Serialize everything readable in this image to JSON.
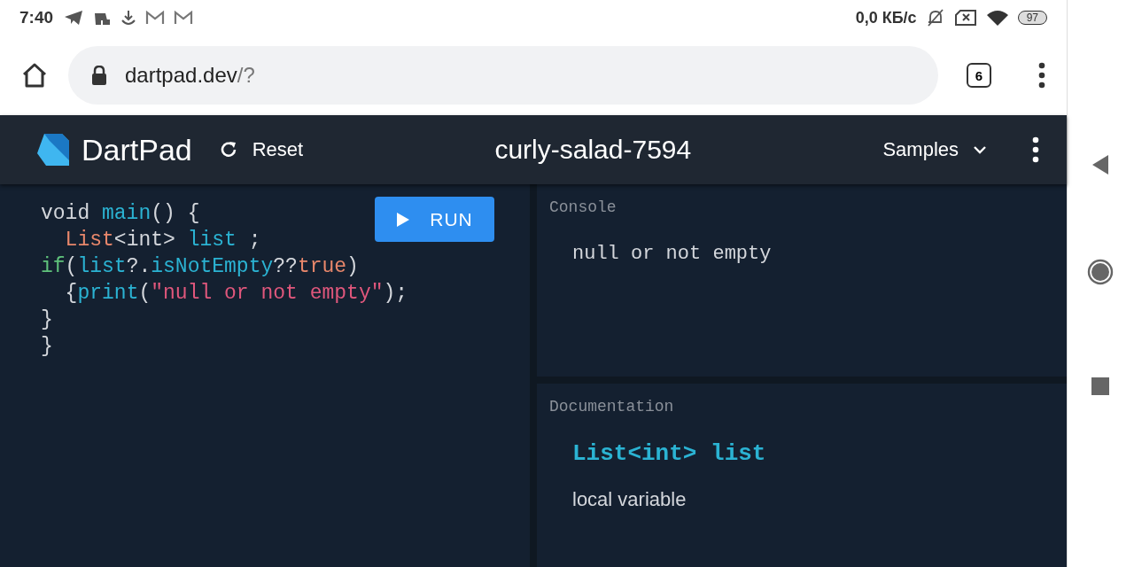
{
  "status_bar": {
    "time": "7:40",
    "net_speed": "0,0 КБ/с",
    "battery": "97"
  },
  "browser": {
    "url_host": "dartpad.dev",
    "url_path": "/?",
    "tab_count": "6"
  },
  "header": {
    "app_name": "DartPad",
    "reset": "Reset",
    "title": "curly-salad-7594",
    "samples": "Samples"
  },
  "editor": {
    "run_label": "RUN",
    "lines": [
      [
        {
          "kind": "plain",
          "text": "void "
        },
        {
          "kind": "ident",
          "text": "main"
        },
        {
          "kind": "plain",
          "text": "() {"
        }
      ],
      [
        {
          "kind": "type",
          "text": "  List"
        },
        {
          "kind": "plain",
          "text": "<int> "
        },
        {
          "kind": "ident",
          "text": "list"
        },
        {
          "kind": "plain",
          "text": " ;"
        }
      ],
      [
        {
          "kind": "keyword",
          "text": "if"
        },
        {
          "kind": "plain",
          "text": "("
        },
        {
          "kind": "ident",
          "text": "list"
        },
        {
          "kind": "plain",
          "text": "?."
        },
        {
          "kind": "ident",
          "text": "isNotEmpty"
        },
        {
          "kind": "plain",
          "text": "??"
        },
        {
          "kind": "type",
          "text": "true"
        },
        {
          "kind": "plain",
          "text": ")"
        }
      ],
      [
        {
          "kind": "plain",
          "text": "  {"
        },
        {
          "kind": "ident",
          "text": "print"
        },
        {
          "kind": "plain",
          "text": "("
        },
        {
          "kind": "string",
          "text": "\"null or not empty\""
        },
        {
          "kind": "plain",
          "text": ");"
        }
      ],
      [
        {
          "kind": "plain",
          "text": "}"
        }
      ],
      [
        {
          "kind": "plain",
          "text": "}"
        }
      ]
    ]
  },
  "console": {
    "label": "Console",
    "output": "null or not empty"
  },
  "documentation": {
    "label": "Documentation",
    "title": "List<int> list",
    "description": "local variable"
  }
}
